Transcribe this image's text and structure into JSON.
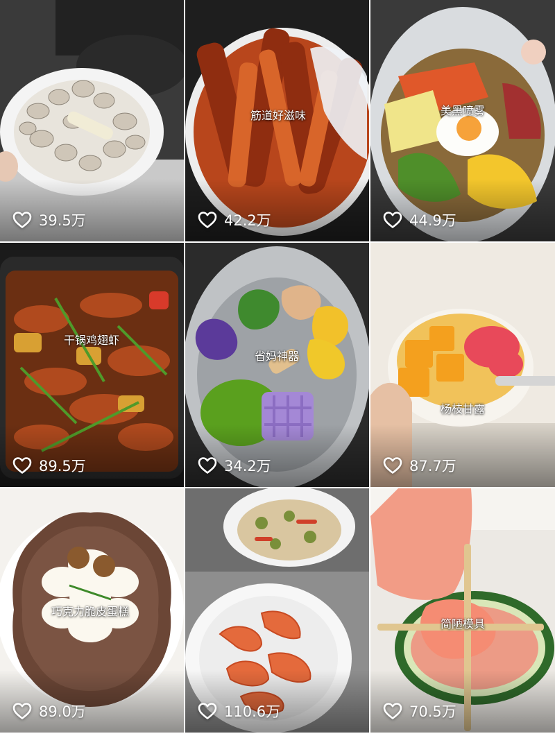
{
  "videos": [
    {
      "caption": "",
      "likes": "39.5万"
    },
    {
      "caption": "筋道好滋味",
      "likes": "42.2万"
    },
    {
      "caption": "美黑喷雾",
      "likes": "44.9万"
    },
    {
      "caption": "干锅鸡翅虾",
      "likes": "89.5万"
    },
    {
      "caption": "省妈神器",
      "likes": "34.2万"
    },
    {
      "caption": "杨枝甘露",
      "likes": "87.7万"
    },
    {
      "caption": "巧克力脆皮蛋糕",
      "likes": "89.0万"
    },
    {
      "caption": "",
      "likes": "110.6万"
    },
    {
      "caption": "简陋模具",
      "likes": "70.5万"
    }
  ],
  "icons": {
    "like": "heart-outline-icon"
  },
  "colors": {
    "likes_text": "#ffffff",
    "background": "#ffffff"
  }
}
